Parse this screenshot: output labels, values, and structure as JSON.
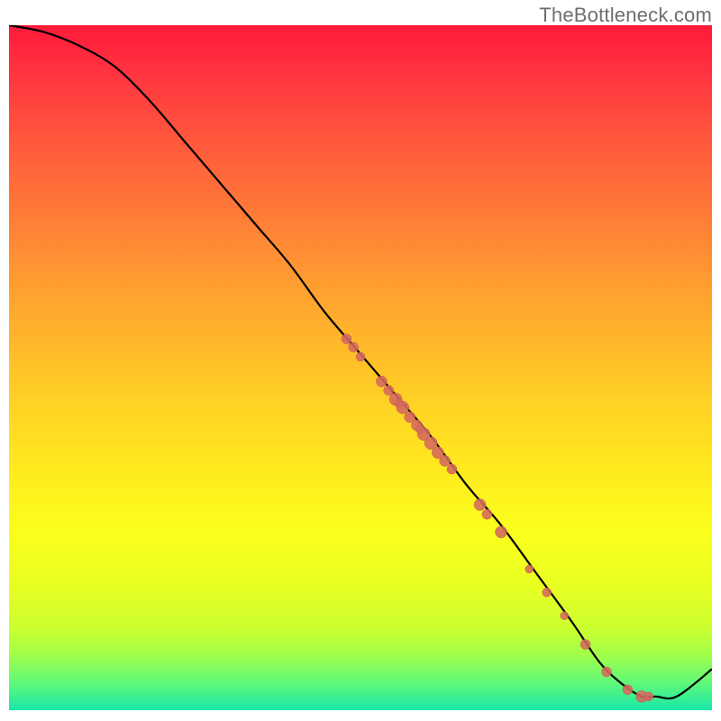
{
  "attribution": "TheBottleneck.com",
  "colors": {
    "gradient_top": "#ff1a3a",
    "gradient_bottom": "#18e8a8",
    "line": "#000000",
    "dot_fill": "#d46a5f",
    "dot_stroke": "#c95a50"
  },
  "chart_data": {
    "type": "line",
    "title": "",
    "xlabel": "",
    "ylabel": "",
    "xlim": [
      0,
      100
    ],
    "ylim": [
      0,
      100
    ],
    "series": [
      {
        "name": "bottleneck-curve",
        "x": [
          0,
          5,
          10,
          15,
          20,
          25,
          30,
          35,
          40,
          45,
          50,
          55,
          60,
          65,
          70,
          75,
          80,
          84,
          87,
          90,
          92,
          95,
          100
        ],
        "y": [
          100,
          99,
          97,
          94,
          89,
          83,
          77,
          71,
          65,
          58,
          52,
          46,
          40,
          33,
          27,
          20,
          13,
          7,
          4,
          2,
          2,
          2,
          6
        ]
      }
    ],
    "scatter_points": {
      "name": "sampled-points",
      "x": [
        48,
        49,
        50,
        53,
        54,
        55,
        55.5,
        56,
        57,
        58,
        58.5,
        59,
        60,
        61,
        62,
        63,
        67,
        68,
        70,
        74,
        76.5,
        79,
        82,
        85,
        88,
        90,
        91
      ],
      "y": [
        54.2,
        53.0,
        51.6,
        48.0,
        46.7,
        45.4,
        44.8,
        44.2,
        42.8,
        41.6,
        41.0,
        40.3,
        39.0,
        37.6,
        36.4,
        35.2,
        30.0,
        28.6,
        26.0,
        20.6,
        17.2,
        13.8,
        9.6,
        5.6,
        3.0,
        2.0,
        2.0
      ],
      "r": [
        5.5,
        5.5,
        5,
        6,
        5.5,
        7,
        5,
        7,
        6,
        6,
        5,
        7,
        7,
        6.5,
        6,
        5.5,
        6.5,
        5.5,
        6.5,
        4.5,
        5,
        4.5,
        5.5,
        5.5,
        5.5,
        6.5,
        5
      ]
    }
  }
}
